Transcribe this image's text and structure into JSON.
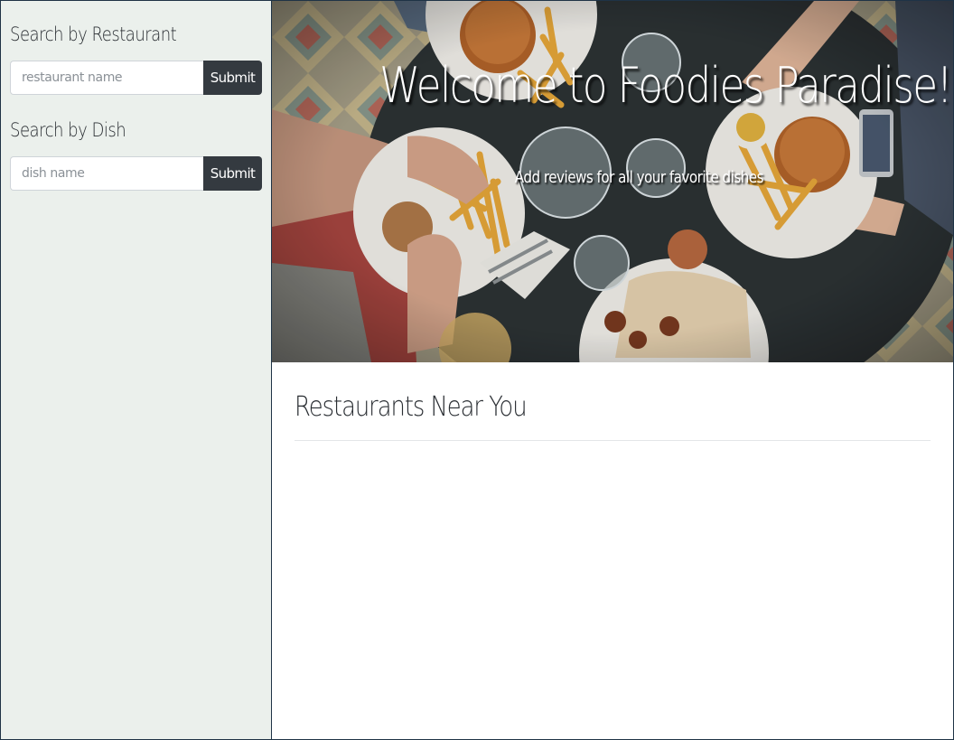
{
  "sidebar": {
    "restaurant_search": {
      "heading": "Search by Restaurant",
      "placeholder": "restaurant name",
      "submit_label": "Submit"
    },
    "dish_search": {
      "heading": "Search by Dish",
      "placeholder": "dish name",
      "submit_label": "Submit"
    }
  },
  "hero": {
    "title": "Welcome to Foodies Paradise!",
    "subtitle": "Add reviews for all your favorite dishes"
  },
  "main": {
    "section_title": "Restaurants Near You"
  },
  "colors": {
    "sidebar_bg": "#ebf0ec",
    "button_bg": "#343a40",
    "border": "#1f3346"
  }
}
